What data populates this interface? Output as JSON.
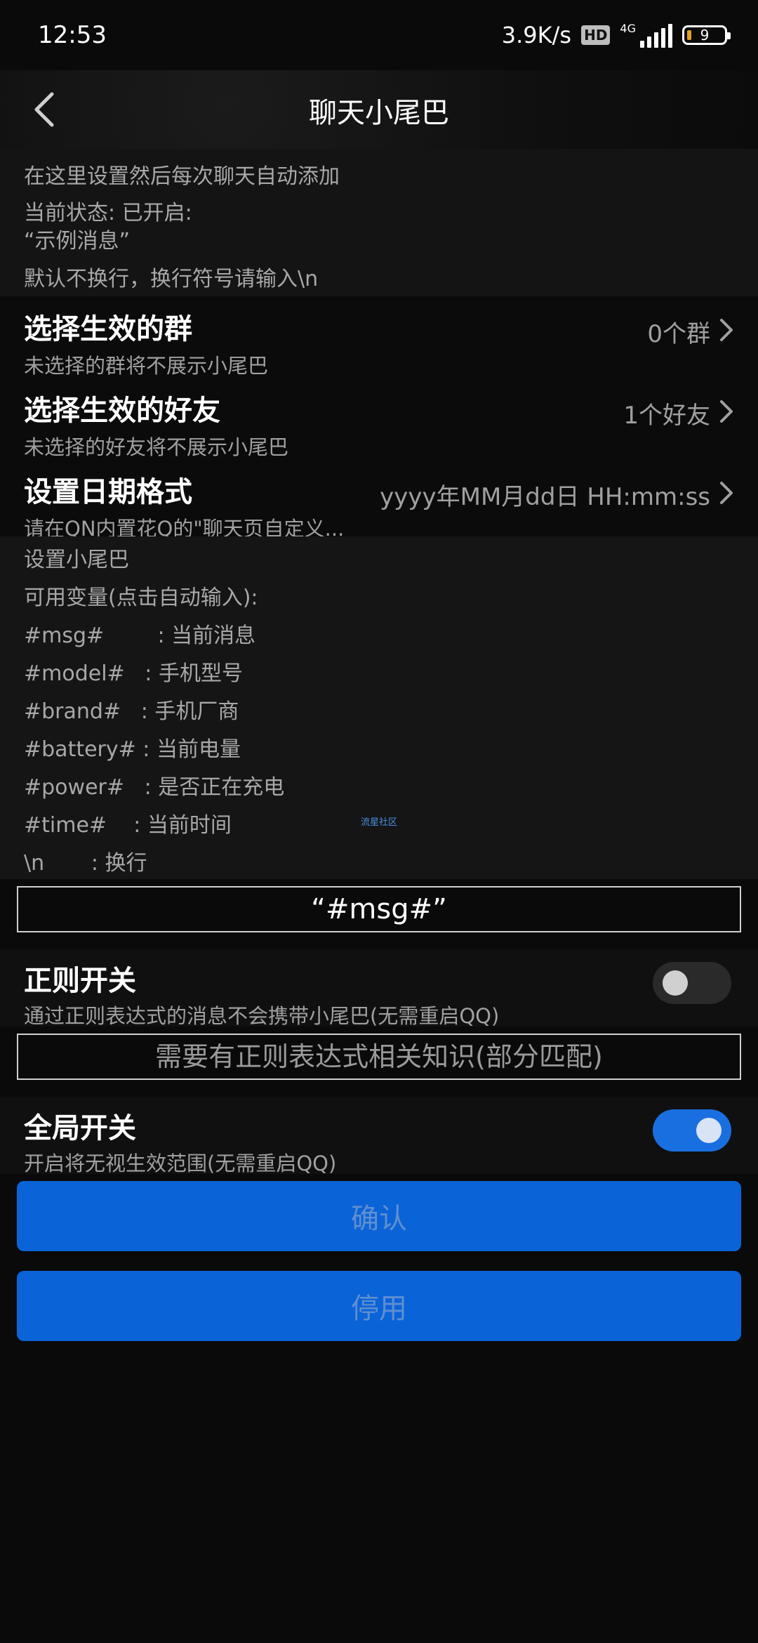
{
  "status": {
    "time": "12:53",
    "net_speed": "3.9K/s",
    "hd": "HD",
    "network": "4G",
    "battery": "9"
  },
  "appbar": {
    "title": "聊天小尾巴"
  },
  "info": {
    "line1": "在这里设置然后每次聊天自动添加",
    "line2": "当前状态: 已开启:",
    "line3": "“示例消息”",
    "line4": "默认不换行，换行符号请输入\\n"
  },
  "groups": {
    "title": "选择生效的群",
    "subtitle": "未选择的群将不展示小尾巴",
    "value": "0个群"
  },
  "friends": {
    "title": "选择生效的好友",
    "subtitle": "未选择的好友将不展示小尾巴",
    "value": "1个好友"
  },
  "date_format": {
    "title": "设置日期格式",
    "subtitle": "请在QN内置花Q的\"聊天页自定义...",
    "value": "yyyy年MM月dd日 HH:mm:ss"
  },
  "variables": {
    "header": "设置小尾巴",
    "hint": "可用变量(点击自动输入):",
    "items": [
      "#msg#        : 当前消息",
      "#model#   : 手机型号",
      "#brand#   : 手机厂商",
      "#battery# : 当前电量",
      "#power#   : 是否正在充电",
      "#time#    : 当前时间",
      "\\n       : 换行"
    ],
    "watermark": "流星社区"
  },
  "tail_input": {
    "value": "“#msg#”"
  },
  "regex": {
    "title": "正则开关",
    "subtitle": "通过正则表达式的消息不会携带小尾巴(无需重启QQ)",
    "placeholder": "需要有正则表达式相关知识(部分匹配)",
    "enabled": false
  },
  "global": {
    "title": "全局开关",
    "subtitle": "开启将无视生效范围(无需重启QQ)",
    "enabled": true
  },
  "buttons": {
    "confirm": "确认",
    "disable": "停用"
  },
  "colors": {
    "accent": "#0b63d8",
    "background": "#0a0a0a"
  }
}
